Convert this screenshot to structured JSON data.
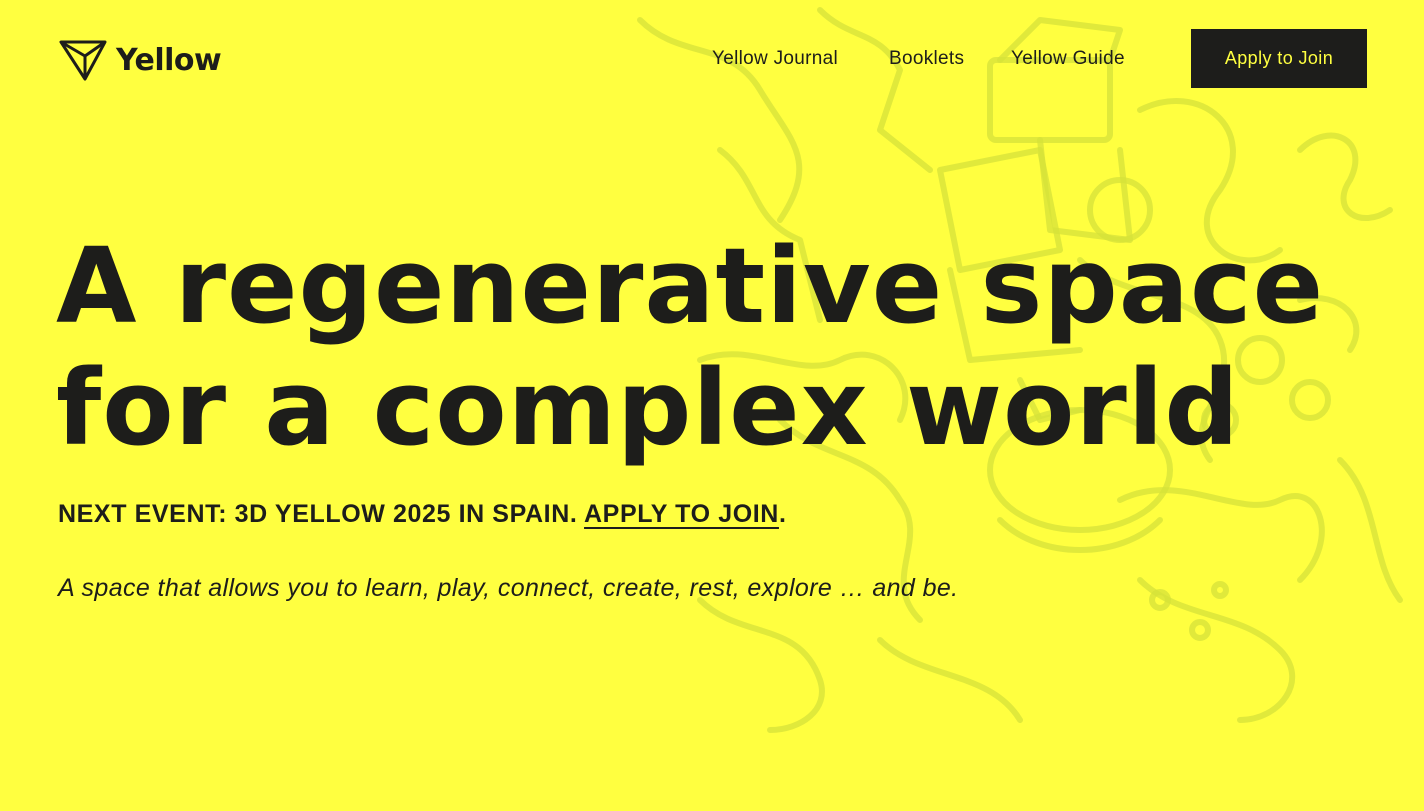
{
  "brand": {
    "name": "Yellow",
    "logo_icon": "triangle-logo-icon",
    "background_color": "#ffff40",
    "ink_color": "#1d1d1b"
  },
  "nav": {
    "items": [
      {
        "label": "Yellow Journal"
      },
      {
        "label": "Booklets"
      },
      {
        "label": "Yellow Guide"
      }
    ],
    "cta_label": "Apply to Join"
  },
  "hero": {
    "title_line_1": "A regenerative space",
    "title_line_2": "for a complex world",
    "event_prefix": "NEXT EVENT: 3D YELLOW 2025 IN SPAIN. ",
    "event_link": "APPLY TO JOIN",
    "event_suffix": ".",
    "tagline": "A space that allows you to learn, play, connect, create, rest, explore … and be."
  }
}
